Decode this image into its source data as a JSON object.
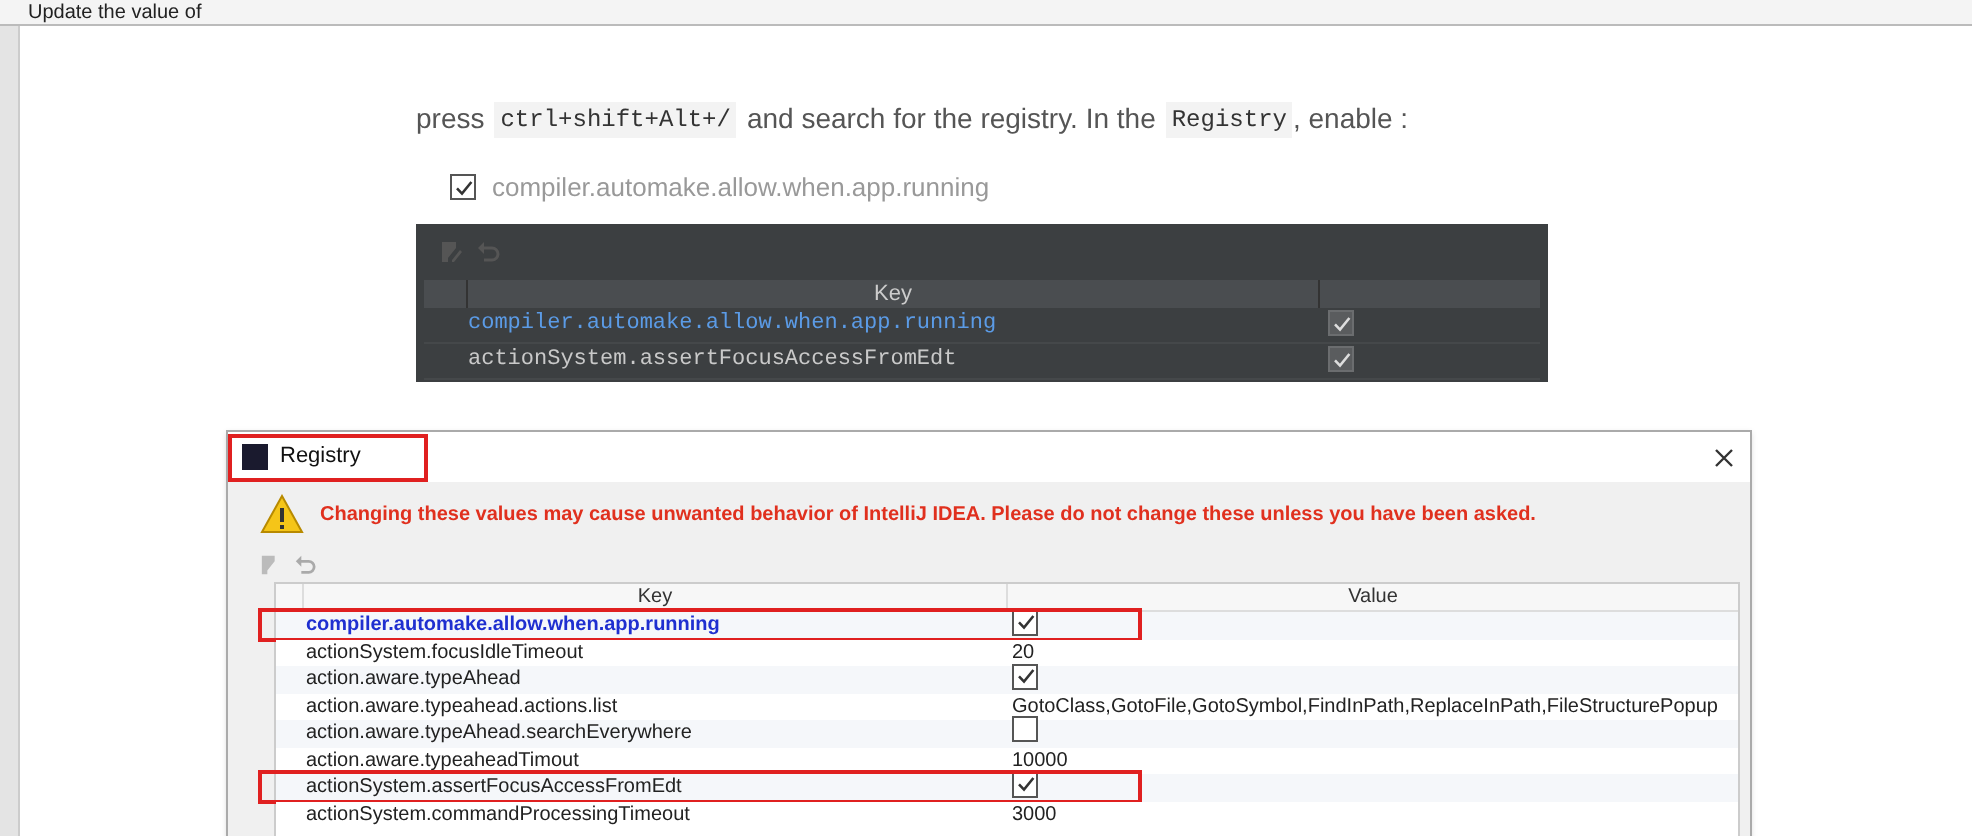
{
  "header": {
    "title": "Update the value of"
  },
  "instruction": {
    "before": "press",
    "shortcut": "ctrl+shift+Alt+/",
    "middle": "and search for the registry. In the",
    "code": "Registry",
    "after": ", enable :"
  },
  "option": {
    "label": "compiler.automake.allow.when.app.running",
    "checked": true
  },
  "dark_table": {
    "column": "Key",
    "rows": [
      {
        "key": "compiler.automake.allow.when.app.running",
        "selected": true,
        "checked": true
      },
      {
        "key": "actionSystem.assertFocusAccessFromEdt",
        "selected": false,
        "checked": true
      }
    ]
  },
  "dialog": {
    "title": "Registry",
    "title_annotated": true,
    "warning": "Changing these values may cause unwanted behavior of IntelliJ IDEA. Please do not change these unless you have been asked.",
    "columns": [
      "Key",
      "Value"
    ],
    "rows": [
      {
        "key": "compiler.automake.allow.when.app.running",
        "kind": "check",
        "checked": true,
        "selected": true,
        "annotated": true
      },
      {
        "key": "actionSystem.focusIdleTimeout",
        "kind": "text",
        "value": "20",
        "selected": false,
        "annotated": false
      },
      {
        "key": "action.aware.typeAhead",
        "kind": "check",
        "checked": true,
        "selected": false,
        "annotated": false
      },
      {
        "key": "action.aware.typeahead.actions.list",
        "kind": "text",
        "value": "GotoClass,GotoFile,GotoSymbol,FindInPath,ReplaceInPath,FileStructurePopup",
        "selected": false,
        "annotated": false
      },
      {
        "key": "action.aware.typeAhead.searchEverywhere",
        "kind": "check",
        "checked": false,
        "selected": false,
        "annotated": false
      },
      {
        "key": "action.aware.typeaheadTimout",
        "kind": "text",
        "value": "10000",
        "selected": false,
        "annotated": false
      },
      {
        "key": "actionSystem.assertFocusAccessFromEdt",
        "kind": "check",
        "checked": true,
        "selected": false,
        "annotated": true
      },
      {
        "key": "actionSystem.commandProcessingTimeout",
        "kind": "text",
        "value": "3000",
        "selected": false,
        "annotated": false
      }
    ]
  }
}
